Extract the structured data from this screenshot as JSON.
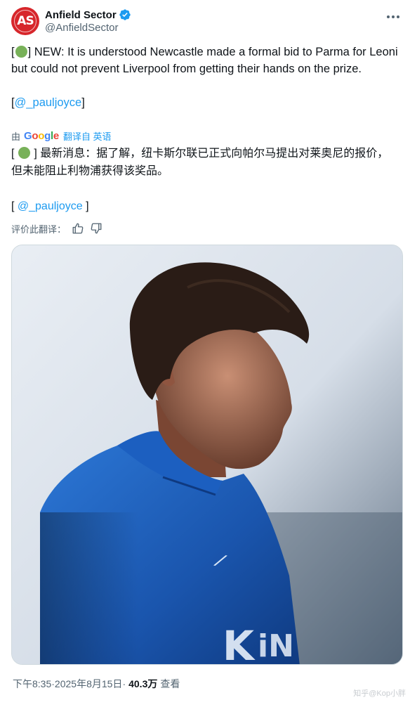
{
  "account": {
    "display_name": "Anfield Sector",
    "handle": "@AnfieldSector",
    "avatar_text": "AS"
  },
  "tweet": {
    "open_bracket": "[",
    "text_after_dot": "] NEW: It is understood Newcastle made a formal bid to Parma for Leoni but could not prevent Liverpool from getting their hands on the prize.",
    "source_open": "[",
    "mention": "@_pauljoyce",
    "source_close": "]"
  },
  "translation": {
    "by_label": "由",
    "provider": "Google",
    "translated_from": "翻译自 英语",
    "open_bracket": "[",
    "text_after_dot": "] 最新消息：据了解，纽卡斯尔联已正式向帕尔马提出对莱奥尼的报价，但未能阻止利物浦获得该奖品。",
    "source_open": "[ ",
    "mention": "@_pauljoyce",
    "source_close": " ]",
    "rate_label": "评价此翻译："
  },
  "meta": {
    "time": "下午8:35",
    "separator1": " · ",
    "date": "2025年8月15日",
    "separator2": " · ",
    "views_count": "40.3万",
    "views_label": "查看"
  },
  "watermark": "知乎@Kop小胖",
  "icons": {
    "verified": "verified-badge-icon",
    "more": "more-icon",
    "thumbs_up": "thumbs-up-icon",
    "thumbs_down": "thumbs-down-icon",
    "status_dot": "green-circle-icon"
  },
  "colors": {
    "accent": "#1d9bf0",
    "secondary_text": "#536471",
    "avatar_bg": "#d7262b",
    "green_dot": "#78b159"
  }
}
